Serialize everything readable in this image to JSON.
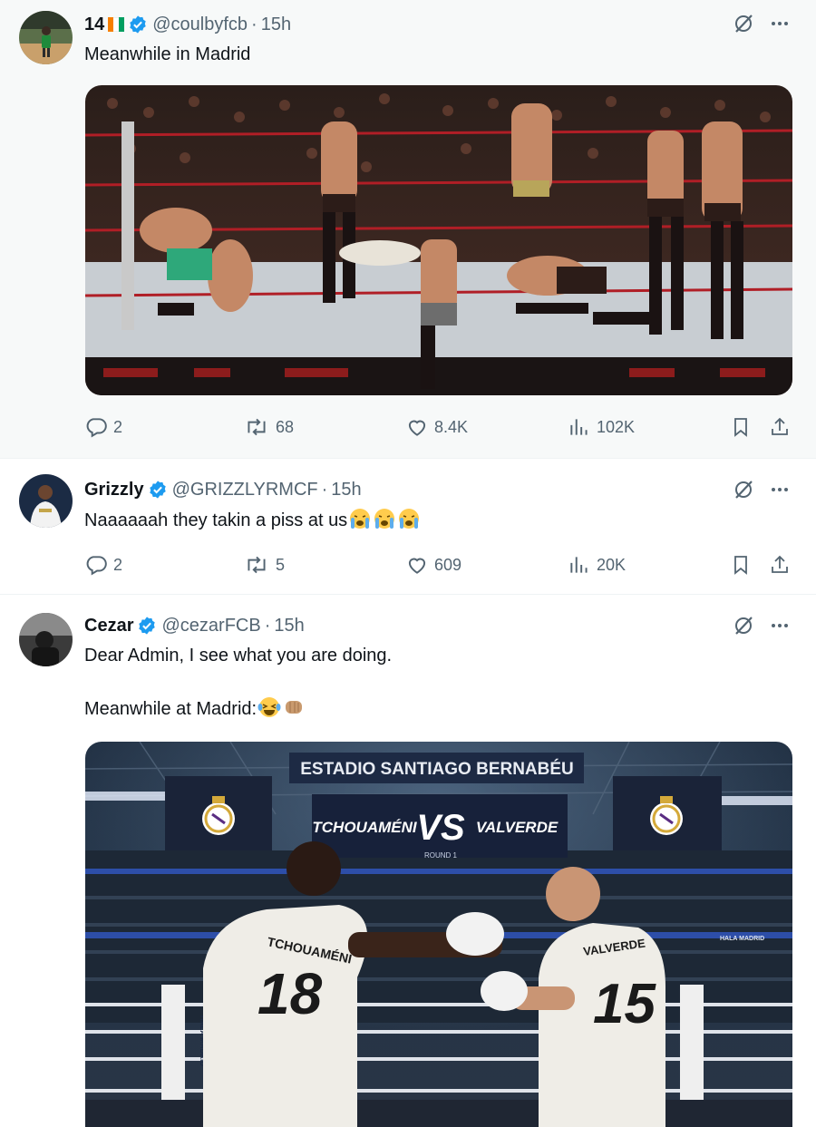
{
  "tweets": [
    {
      "name": "14",
      "handle": "@coulbyfcb",
      "time": "15h",
      "text": "Meanwhile in Madrid",
      "stats": {
        "replies": "2",
        "reposts": "68",
        "likes": "8.4K",
        "views": "102K"
      },
      "colors": {
        "flag": [
          "#f77f00",
          "#ffffff",
          "#009e60"
        ]
      }
    },
    {
      "name": "Grizzly",
      "handle": "@GRIZZLYRMCF",
      "time": "15h",
      "text": "Naaaaaah they takin a piss at us",
      "emoji": [
        "crying-face-emoji",
        "crying-face-emoji",
        "crying-face-emoji"
      ],
      "stats": {
        "replies": "2",
        "reposts": "5",
        "likes": "609",
        "views": "20K"
      }
    },
    {
      "name": "Cezar",
      "handle": "@cezarFCB",
      "time": "15h",
      "text_line1": "Dear Admin, I see what you are doing.",
      "text_line2": "Meanwhile at Madrid:",
      "emoji": [
        "laughing-tears-emoji",
        "fist-bump-emoji"
      ],
      "poster": {
        "stadium": "ESTADIO SANTIAGO BERNABÉU",
        "left_fighter": "TCHOUAMÉNI",
        "vs": "VS",
        "right_fighter": "VALVERDE",
        "round": "ROUND 1",
        "left_number": "18",
        "right_number": "15",
        "left_jersey_name": "TCHOUAMÉNI",
        "right_jersey_name": "VALVERDE",
        "banner": "HALA MADRID",
        "corner_pad": "HALA MADRID"
      }
    }
  ],
  "theme": {
    "verified": "#1d9bf0",
    "muted": "#536471",
    "text": "#0f1419"
  },
  "dot": "·"
}
